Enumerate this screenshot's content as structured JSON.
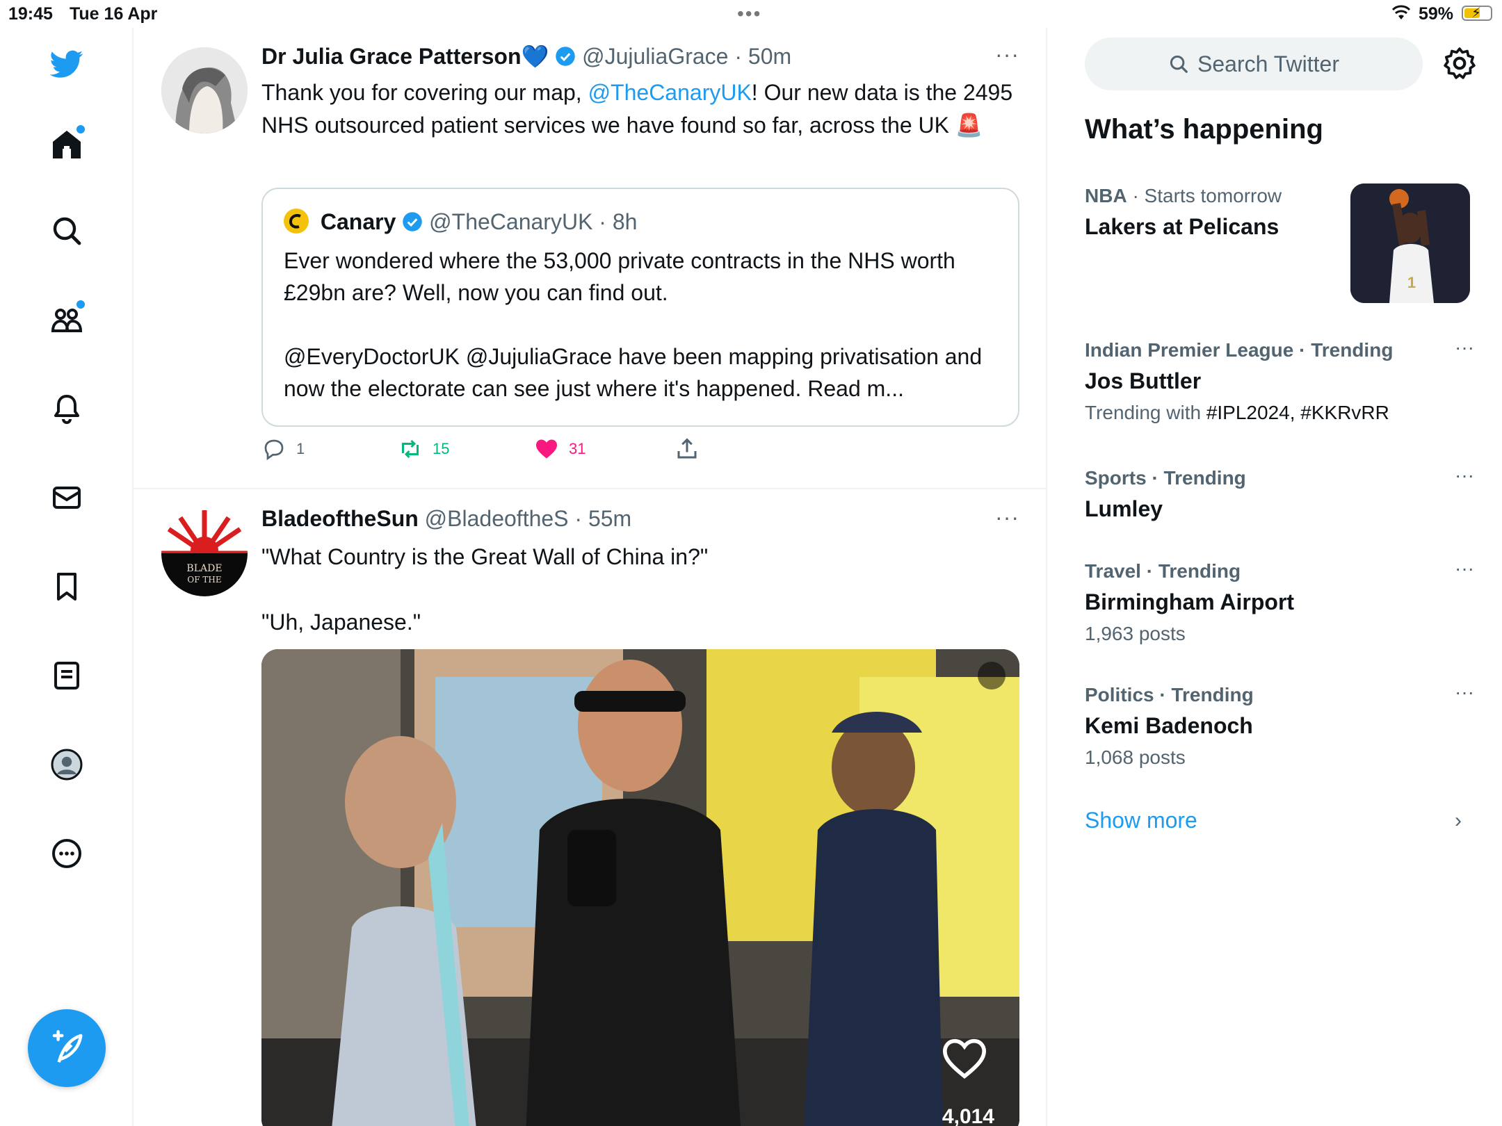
{
  "status_bar": {
    "time": "19:45",
    "date": "Tue 16 Apr",
    "center": "•••",
    "battery": "59%"
  },
  "nav": {
    "items": [
      "twitter-logo",
      "home",
      "explore",
      "communities",
      "notifications",
      "messages",
      "bookmarks",
      "lists",
      "profile",
      "more"
    ],
    "compose_icon": "compose-tweet-icon"
  },
  "tweets": [
    {
      "name": "Dr Julia Grace Patterson💙",
      "handle": "@JujuliaGrace",
      "time": "· 50m",
      "more": "···",
      "text_1": "Thank you for covering our map, ",
      "link": "@TheCanaryUK",
      "text_2": "! Our new data is the 2495 NHS outsourced patient services we have found so far, across the UK 🚨",
      "quote": {
        "name": "Canary",
        "handle": "@TheCanaryUK",
        "time": "· 8h",
        "text": "Ever wondered where the 53,000 private contracts in the NHS worth £29bn are? Well, now you can find out.",
        "text_2": "@EveryDoctorUK @JujuliaGrace have been mapping privatisation and now the electorate can see just where it's happened. Read m..."
      },
      "replies": "1",
      "retweets": "15",
      "likes": "31"
    },
    {
      "name": "BladeoftheSun",
      "handle": "@BladeoftheS",
      "time": "· 55m",
      "more": "···",
      "text_1": "\"What Country is the Great Wall of China in?\"",
      "text_2": "\"Uh, Japanese.\"",
      "avatar_text": "BLADE OF THE",
      "video_likes": "4,014"
    }
  ],
  "sidebar": {
    "search_placeholder": "Search Twitter",
    "whats_happening": "What’s happening",
    "trends": [
      {
        "category": "NBA",
        "context": "· Starts tomorrow",
        "title": "Lakers at Pelicans"
      },
      {
        "category": "Indian Premier League · Trending",
        "title": "Jos Buttler",
        "sub_prefix": "Trending with ",
        "sub_tags": "#IPL2024, #KKRvRR"
      },
      {
        "category": "Sports · Trending",
        "title": "Lumley"
      },
      {
        "category": "Travel · Trending",
        "title": "Birmingham Airport",
        "sub": "1,963 posts"
      },
      {
        "category": "Politics · Trending",
        "title": "Kemi Badenoch",
        "sub": "1,068 posts"
      }
    ],
    "trend_more": "···",
    "show_more": "Show more",
    "show_more_chevron": "›"
  },
  "colors": {
    "accent": "#1d9bf0",
    "like": "#f91880",
    "retweet": "#00ba7c",
    "text_secondary": "#536471"
  }
}
